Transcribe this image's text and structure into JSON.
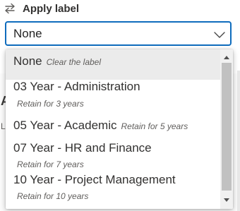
{
  "header": {
    "title": "Apply label",
    "icon": "swap-arrows-icon"
  },
  "select": {
    "value": "None",
    "chevron_icon": "chevron-down-icon",
    "border_color": "#0f6cbd"
  },
  "options": [
    {
      "label": "None",
      "description": "Clear the label",
      "selected": true
    },
    {
      "label": "03 Year - Administration",
      "description": "Retain for 3 years",
      "selected": false
    },
    {
      "label": "05 Year - Academic",
      "description": "Retain for 5 years",
      "selected": false
    },
    {
      "label": "07 Year - HR and Finance",
      "description": "Retain for 7 years",
      "selected": false
    },
    {
      "label": "10 Year - Project Management",
      "description": "Retain for 10 years",
      "selected": false
    }
  ],
  "colors": {
    "selected_background": "#ebebeb",
    "scrollbar_thumb": "#c1c1c1",
    "scrollbar_track": "#f1f1f1"
  }
}
